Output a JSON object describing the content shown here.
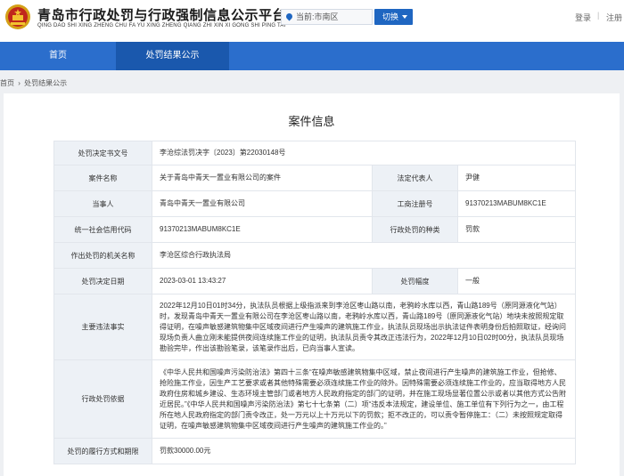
{
  "header": {
    "title": "青岛市行政处罚与行政强制信息公示平台",
    "subtitle": "QING DAO SHI XING ZHENG CHU FA YU XING ZHENG QIANG ZHI XIN XI GONG SHI PING TAI",
    "region": "当前:市南区",
    "switch_label": "切换",
    "login": "登录",
    "separator": "|",
    "register": "注册"
  },
  "nav": {
    "home": "首页",
    "active": "处罚结果公示"
  },
  "breadcrumb": {
    "home": "首页",
    "arrow": "›",
    "current": "处罚结果公示"
  },
  "case": {
    "title": "案件信息",
    "labels": {
      "decision_no": "处罚决定书文号",
      "case_name": "案件名称",
      "legal_rep": "法定代表人",
      "party": "当事人",
      "biz_reg_no": "工商注册号",
      "credit_code": "统一社会信用代码",
      "penalty_type": "行政处罚的种类",
      "authority": "作出处罚的机关名称",
      "decision_date": "处罚决定日期",
      "penalty_level": "处罚幅度",
      "facts": "主要违法事实",
      "basis": "行政处罚依据",
      "fulfillment": "处罚的履行方式和期限"
    },
    "values": {
      "decision_no": "李沧综法罚决字〔2023〕第22030148号",
      "case_name": "关于青岛中青天一置业有限公司的案件",
      "legal_rep": "尹健",
      "party": "青岛中青天一置业有限公司",
      "biz_reg_no": "91370213MABUM8KC1E",
      "credit_code": "91370213MABUM8KC1E",
      "penalty_type": "罚款",
      "authority": "李沧区综合行政执法局",
      "decision_date": "2023-03-01 13:43:27",
      "penalty_level": "一般",
      "facts": "2022年12月10日01时34分，执法队员根据上级指派来到李沧区枣山路以南，老鸦岭水库以西，青山路189号（原同源液化气站）时，发现青岛中青天一置业有限公司在李沧区枣山路以南，老鸦岭水库以西，青山路189号（原同源液化气站）地块未按照规定取得证明，在噪声敏感建筑物集中区域夜间进行产生噪声的建筑施工作业，执法队员现场出示执法证件表明身份后拍照取证，经询问现场负责人曲立刚未能提供夜间连续施工作业的证明，执法队员责令其改正违法行为，2022年12月10日02时00分，执法队员现场勘验完毕，作出该勘验笔录，该笔录作出后，已向当事人宣读。",
      "basis": "《中华人民共和国噪声污染防治法》第四十三条“在噪声敏感建筑物集中区域，禁止夜间进行产生噪声的建筑施工作业，但抢修、抢险施工作业，因生产工艺要求或者其他特殊需要必须连续施工作业的除外。因特殊需要必须连续施工作业的，应当取得地方人民政府住房和城乡建设、生态环境主管部门或者地方人民政府指定的部门的证明，并在施工现场显著位置公示或者以其他方式公告附近居民。”《中华人民共和国噪声污染防治法》第七十七条第（二）项“违反本法规定，建设单位、施工单位有下列行为之一，由工程所在地人民政府指定的部门责令改正，处一万元以上十万元以下的罚款；拒不改正的，可以责令暂停施工：（二）未按照规定取得证明，在噪声敏感建筑物集中区域夜间进行产生噪声的建筑施工作业的。”",
      "fulfillment": "罚款30000.00元"
    }
  },
  "colors": {
    "nav_bg": "#2b6ecc",
    "nav_active_bg": "#1a58ad",
    "switch_btn": "#1f66c1",
    "label_cell_bg": "#edf1f6"
  },
  "icons": [
    "emblem-icon",
    "location-pin-icon",
    "chevron-down-icon"
  ]
}
